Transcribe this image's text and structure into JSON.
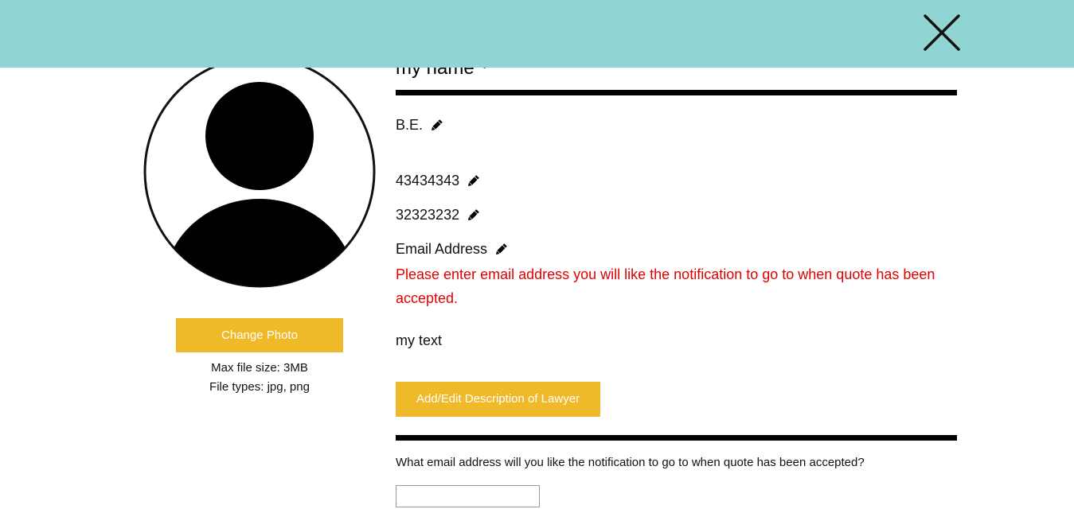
{
  "profile": {
    "name": "my name",
    "degree": "B.E.",
    "phone_1": "43434343",
    "phone_2": "32323232",
    "email_label": "Email Address",
    "email_warning": "Please enter email address you will like the notification to go to when quote has been accepted.",
    "description": "my text"
  },
  "photo": {
    "change_label": "Change Photo",
    "max_size": "Max file size: 3MB",
    "file_types": "File types: jpg, png"
  },
  "actions": {
    "edit_description_label": "Add/Edit Description of Lawyer"
  },
  "notification": {
    "question": "What email address will you like the notification to go to when quote has been accepted?",
    "email_value": "",
    "email_placeholder": ""
  },
  "icons": {
    "close": "close-icon",
    "edit": "pencil-icon",
    "avatar": "user-avatar-icon"
  },
  "colors": {
    "banner": "#91d4d4",
    "accent_button": "#f0b929",
    "warning_text": "#e00000"
  }
}
